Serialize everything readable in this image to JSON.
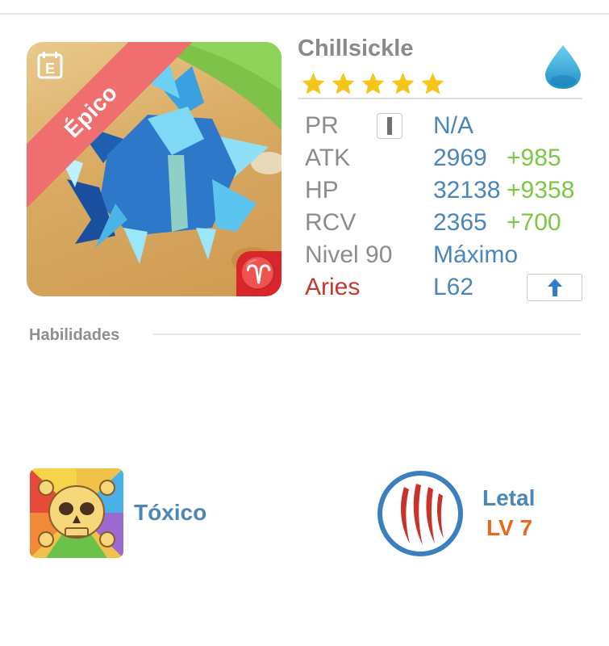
{
  "creature": {
    "name": "Chillsickle",
    "rarity": "Épico",
    "stars": 5,
    "element_icon": "water-drop-icon",
    "zodiac_symbol": "♈"
  },
  "stats": {
    "pr": {
      "label": "PR",
      "value": "N/A"
    },
    "atk": {
      "label": "ATK",
      "value": "2969",
      "bonus": "+985"
    },
    "hp": {
      "label": "HP",
      "value": "32138",
      "bonus": "+9358"
    },
    "rcv": {
      "label": "RCV",
      "value": "2365",
      "bonus": "+700"
    },
    "level": {
      "label": "Nivel 90",
      "value": "Máximo"
    },
    "zodiac": {
      "label": "Aries",
      "value": "L62"
    }
  },
  "skills": {
    "section_title": "Habilidades",
    "skill": {
      "name": "Tóxico",
      "icon": "skull-icon"
    },
    "trait": {
      "name": "Letal",
      "level": "LV 7",
      "icon": "claw-marks-icon"
    }
  },
  "colors": {
    "accent_blue": "#4a86b8",
    "bonus_green": "#7ac943",
    "aries_red": "#c23a32",
    "rarity_ribbon": "#ef6f6f",
    "trait_level_orange": "#e8691e",
    "star_gold": "#f5c518"
  }
}
